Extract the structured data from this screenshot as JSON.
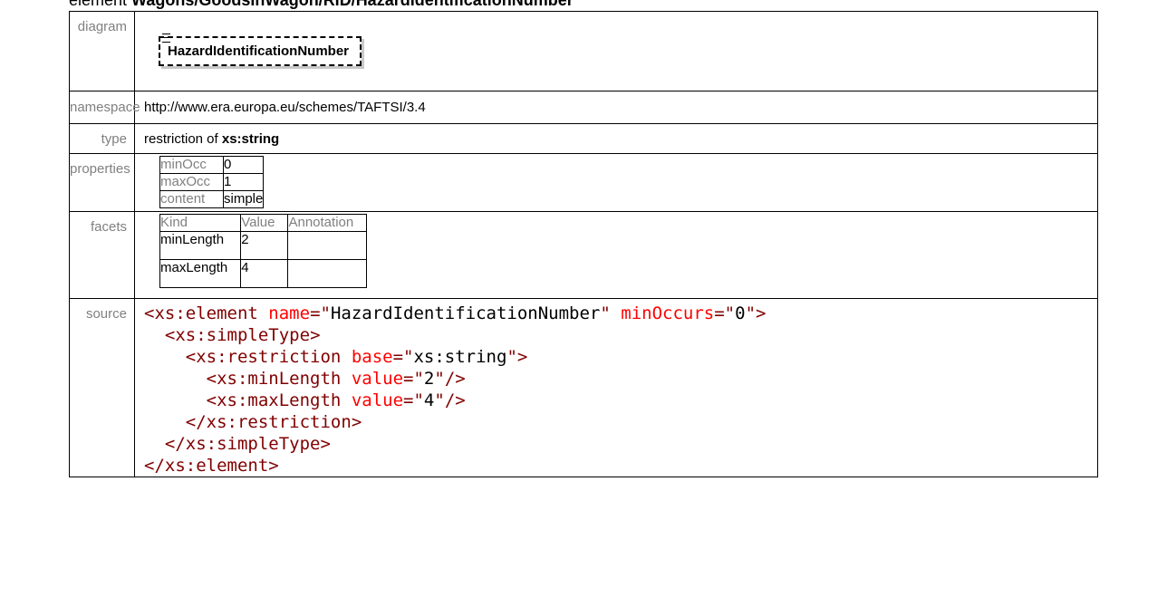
{
  "title": {
    "prefix": "element ",
    "path": "Wagons/GoodsInWagon/RID/HazardIdentificationNumber"
  },
  "labels": {
    "diagram": "diagram",
    "namespace": "namespace",
    "type": "type",
    "properties": "properties",
    "facets": "facets",
    "source": "source"
  },
  "diagram": {
    "element_name": "HazardIdentificationNumber",
    "icon": "document-lines-icon"
  },
  "namespace": "http://www.era.europa.eu/schemes/TAFTSI/3.4",
  "type": {
    "prefix": "restriction of ",
    "base": "xs:string"
  },
  "properties": [
    {
      "key": "minOcc",
      "value": "0"
    },
    {
      "key": "maxOcc",
      "value": "1"
    },
    {
      "key": "content",
      "value": "simple"
    }
  ],
  "facets": {
    "headers": [
      "Kind",
      "Value",
      "Annotation"
    ],
    "rows": [
      {
        "kind": "minLength",
        "value": "2",
        "annotation": ""
      },
      {
        "kind": "maxLength",
        "value": "4",
        "annotation": ""
      }
    ]
  },
  "source": {
    "el_open": "xs:element",
    "name_attr": "name",
    "name_val": "HazardIdentificationNumber",
    "minocc_attr": "minOccurs",
    "minocc_val": "0",
    "simple_type": "xs:simpleType",
    "restriction": "xs:restriction",
    "base_attr": "base",
    "base_val": "xs:string",
    "minlength": "xs:minLength",
    "maxlength": "xs:maxLength",
    "value_attr": "value",
    "minlength_val": "2",
    "maxlength_val": "4"
  },
  "colors": {
    "tag": "#800000",
    "attr": "#ff0000",
    "label": "#808080"
  }
}
